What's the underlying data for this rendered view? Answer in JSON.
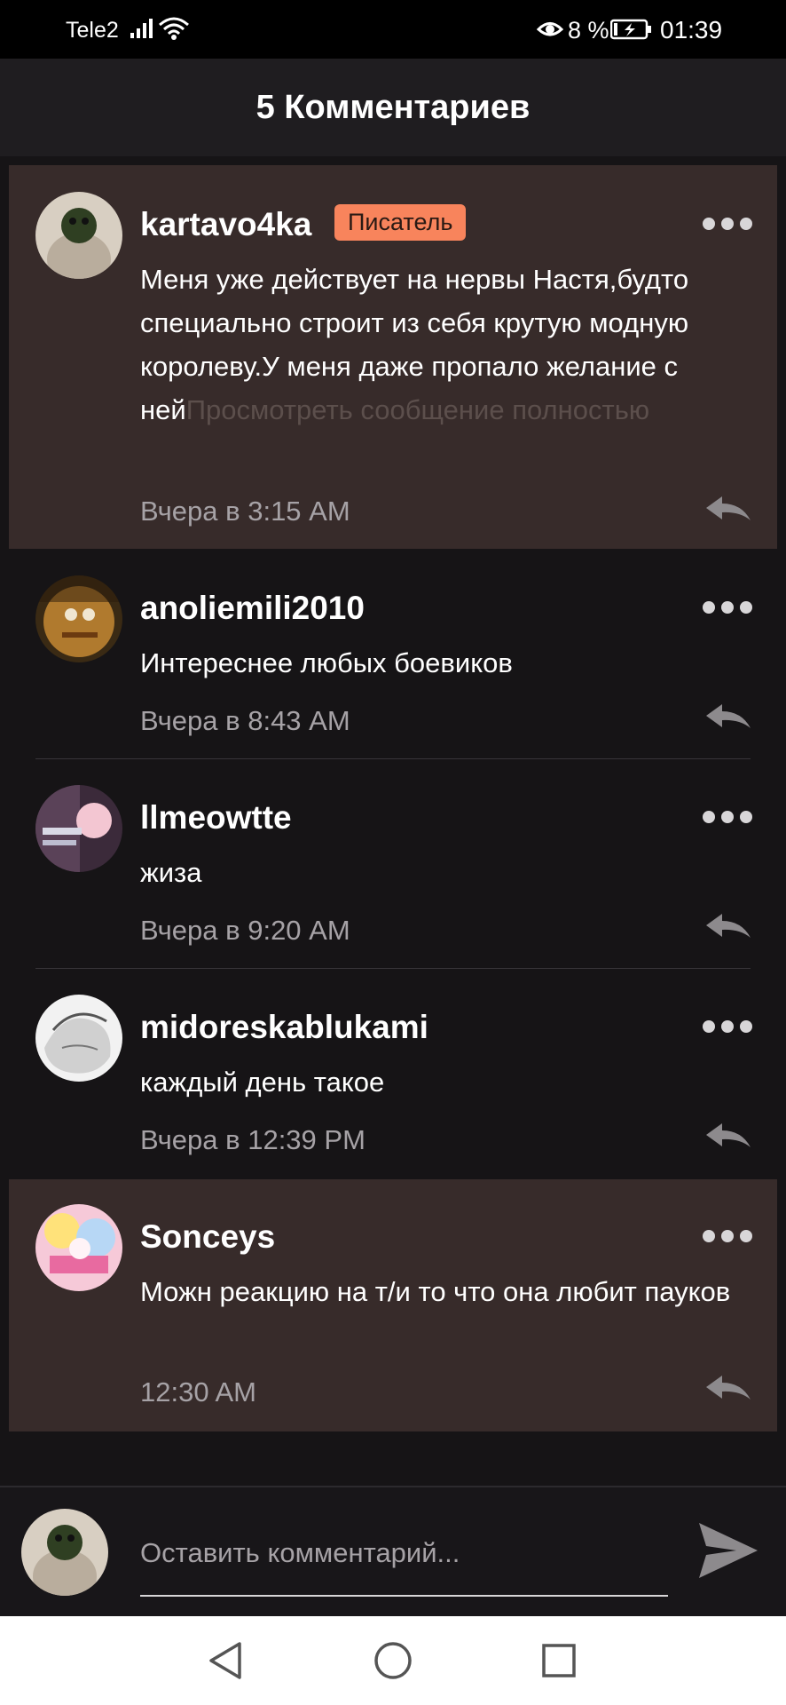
{
  "status_bar": {
    "carrier": "Tele2",
    "battery_percent": "8 %",
    "time": "01:39",
    "icons": [
      "signal-icon",
      "wifi-icon",
      "eye-icon",
      "battery-charging-icon"
    ]
  },
  "header": {
    "title": "5 Комментариев"
  },
  "comments": [
    {
      "username": "kartavo4ka",
      "badge": "Писатель",
      "text": "Меня уже действует на нервы Настя,будто специально строит из себя крутую модную королеву.У меня даже пропало желание с ней",
      "more_link": "Просмотреть сообщение полностью",
      "timestamp": "Вчера в 3:15 AM"
    },
    {
      "username": "anoliemili2010",
      "text": "Интереснее любых боевиков",
      "timestamp": "Вчера в 8:43 AM"
    },
    {
      "username": "llmeowtte",
      "text": "жиза",
      "timestamp": "Вчера в 9:20 AM"
    },
    {
      "username": "midoreskablukami",
      "text": "каждый день такое",
      "timestamp": "Вчера в 12:39 PM"
    },
    {
      "username": "Sonceys",
      "text": "Можн реакцию на т/и то что она любит пауков",
      "timestamp": "12:30 AM"
    }
  ],
  "composer": {
    "placeholder": "Оставить комментарий..."
  },
  "colors": {
    "highlight_bg": "#372b2a",
    "badge": "#f8845c",
    "background": "#161416"
  }
}
